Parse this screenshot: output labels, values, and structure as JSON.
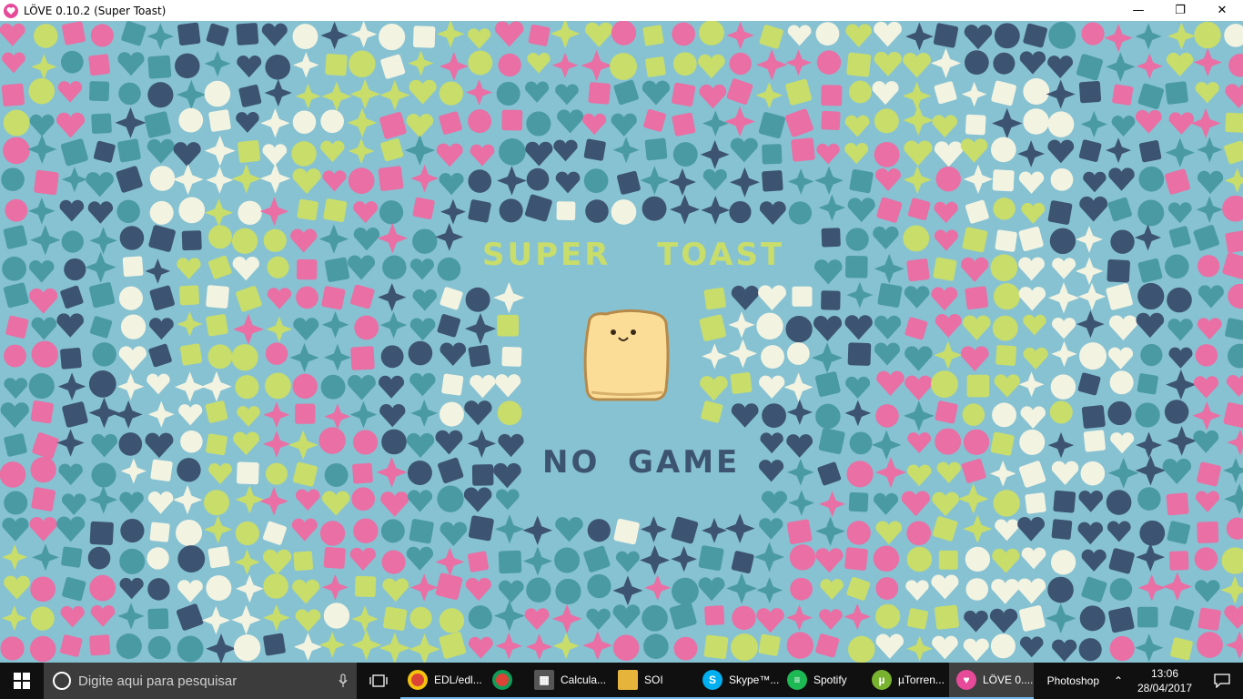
{
  "window": {
    "title": "LÖVE 0.10.2 (Super Toast)",
    "minimize": "—",
    "maximize": "❐",
    "close": "✕"
  },
  "game": {
    "title_left": "SUPER",
    "title_right": "TOAST",
    "subtitle_left": "NO",
    "subtitle_right": "GAME",
    "colors": {
      "background": "#87c2d2",
      "pink": "#e96fa4",
      "lime": "#c8dd6a",
      "cream": "#f3f3e2",
      "navy": "#3c5471",
      "teal": "#4a9aa4",
      "toast": "#fcdd97",
      "toast_outline": "#b68a4a"
    }
  },
  "taskbar": {
    "search_placeholder": "Digite aqui para pesquisar",
    "items": [
      {
        "label": "EDL/edl...",
        "icon": "chrome-icon",
        "color": "#db4437"
      },
      {
        "label": "",
        "icon": "chrome-icon",
        "color": "#db4437"
      },
      {
        "label": "Calcula...",
        "icon": "calculator-icon",
        "color": "#555555"
      },
      {
        "label": "SOI",
        "icon": "folder-icon",
        "color": "#e6b33b"
      },
      {
        "label": "Skype™...",
        "icon": "skype-icon",
        "color": "#00aff0"
      },
      {
        "label": "Spotify",
        "icon": "spotify-icon",
        "color": "#1db954"
      },
      {
        "label": "µTorren...",
        "icon": "utorrent-icon",
        "color": "#78b22f"
      },
      {
        "label": "LÖVE 0....",
        "icon": "love-icon",
        "color": "#e74a99"
      }
    ],
    "tray_label": "Photoshop",
    "time": "13:06",
    "date": "28/04/2017"
  }
}
